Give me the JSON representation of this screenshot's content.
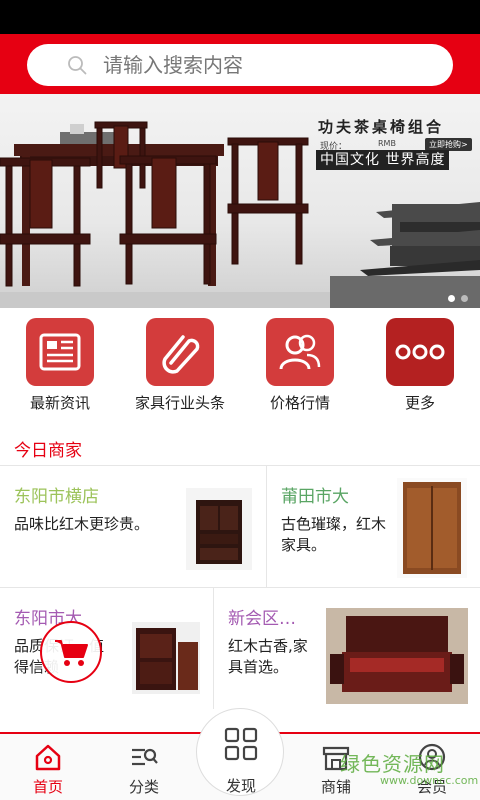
{
  "header": {
    "search_placeholder": "请输入搜索内容",
    "accent_color": "#e60012"
  },
  "banner": {
    "title": "功夫茶桌椅组合",
    "price_label": "现价：",
    "price_unit": "RMB",
    "buy_label": "立即抢购>",
    "slogan": "中国文化 世界高度",
    "page_count": 2,
    "active_page": 1
  },
  "quick_nav": [
    {
      "label": "最新资讯",
      "icon": "newspaper-icon"
    },
    {
      "label": "家具行业头条",
      "icon": "paperclip-icon"
    },
    {
      "label": "价格行情",
      "icon": "users-icon"
    },
    {
      "label": "更多",
      "icon": "more-dots-icon"
    }
  ],
  "section_title": "今日商家",
  "shops": [
    {
      "name": "东阳市横店",
      "desc": "品味比红木更珍贵。",
      "name_color": "#9cc35a"
    },
    {
      "name": "莆田市大",
      "desc": "古色璀璨，红木家具。",
      "name_color": "#5aa564"
    },
    {
      "name": "东阳市大",
      "desc": "品质保证，值得信赖",
      "name_color": "#a45bb2"
    },
    {
      "name": "新会区…",
      "desc": "红木古香,家具首选。",
      "name_color": "#a45bb2"
    }
  ],
  "tabbar": {
    "items": [
      {
        "label": "首页",
        "icon": "home-icon",
        "active": true
      },
      {
        "label": "分类",
        "icon": "category-search-icon",
        "active": false
      },
      {
        "label": "发现",
        "icon": "grid-icon",
        "active": false
      },
      {
        "label": "商铺",
        "icon": "store-icon",
        "active": false
      },
      {
        "label": "会员",
        "icon": "user-icon",
        "active": false
      }
    ]
  },
  "watermark": {
    "text": "绿色资源网",
    "url": "www.downcc.com"
  }
}
